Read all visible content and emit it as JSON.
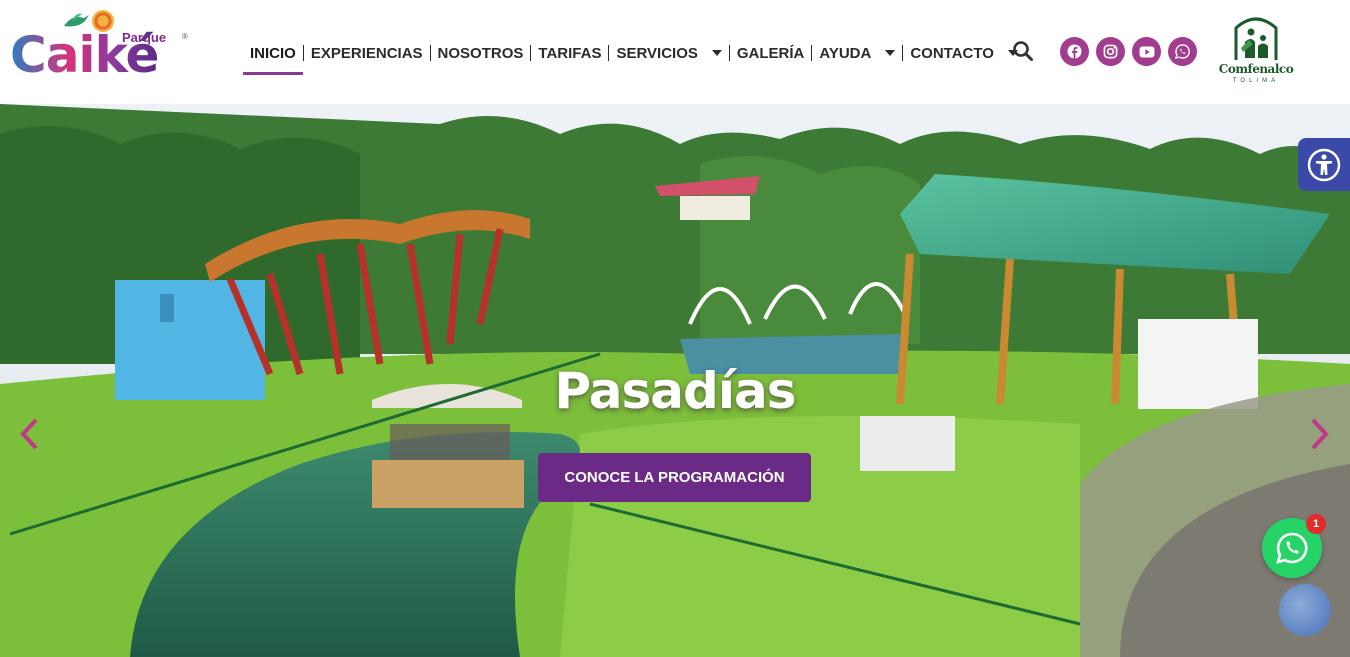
{
  "brand": {
    "logo_top": "Parque",
    "logo_main": "Caiké",
    "logo_registered": "®",
    "partner_name": "Comfenalco",
    "partner_sub": "TOLIMA"
  },
  "nav": {
    "items": [
      {
        "label": "INICIO",
        "active": true
      },
      {
        "label": "EXPERIENCIAS"
      },
      {
        "label": "NOSOTROS"
      },
      {
        "label": "TARIFAS"
      },
      {
        "label": "SERVICIOS",
        "dropdown": true
      },
      {
        "label": "GALERÍA"
      },
      {
        "label": "AYUDA",
        "dropdown": true
      },
      {
        "label": "CONTACTO",
        "dropdown": true
      }
    ]
  },
  "social": {
    "icons": [
      "facebook-icon",
      "instagram-icon",
      "youtube-icon",
      "whatsapp-icon"
    ],
    "color": "#a23c8f"
  },
  "hero": {
    "title": "Pasadías",
    "cta_label": "CONOCE LA PROGRAMACIÓN",
    "cta_color": "#6b2a86"
  },
  "floating": {
    "whatsapp_badge": "1",
    "accessibility_color": "#3b4aa8",
    "whatsapp_color": "#25d366"
  }
}
